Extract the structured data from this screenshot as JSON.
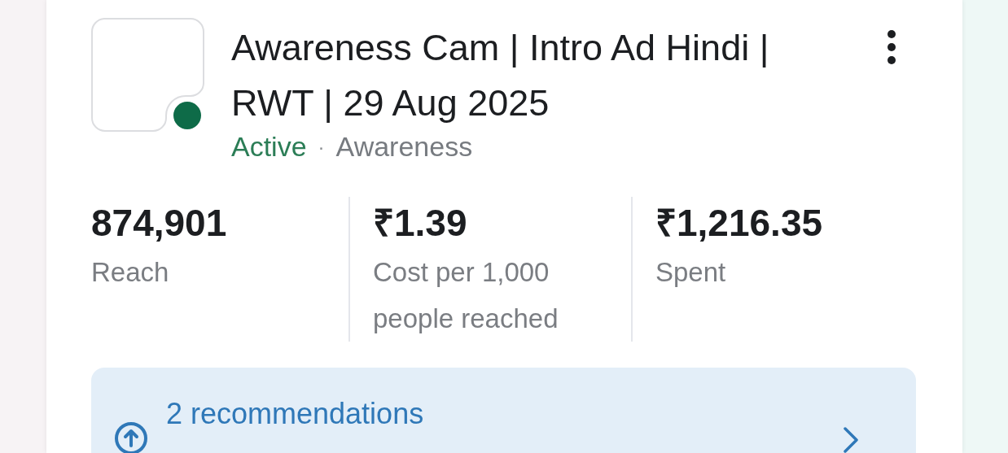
{
  "campaign": {
    "title": "Awareness Cam | Intro Ad Hindi | RWT | 29 Aug 2025",
    "status": "Active",
    "objective": "Awareness",
    "separator": "·"
  },
  "metrics": [
    {
      "value": "874,901",
      "label": "Reach"
    },
    {
      "value": "₹1.39",
      "label": "Cost per 1,000 people reached"
    },
    {
      "value": "₹1,216.35",
      "label": "Spent"
    }
  ],
  "recommendations": {
    "text": "2 recommendations"
  }
}
